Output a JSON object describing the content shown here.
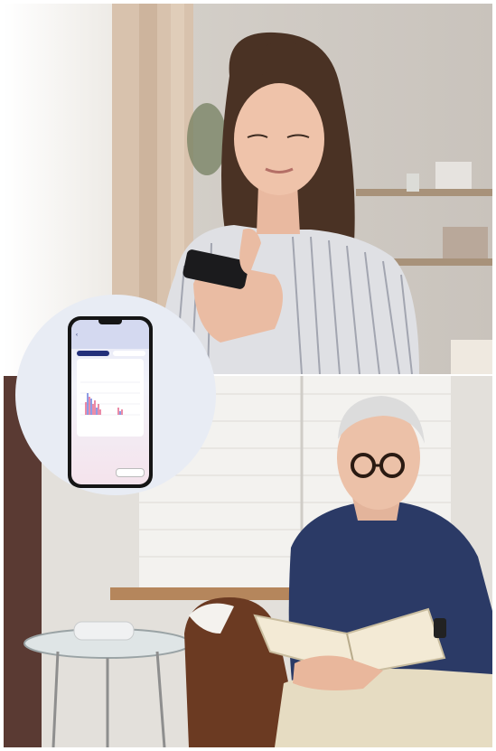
{
  "phone_screen": {
    "header_small": "",
    "title": "",
    "tabs": [
      "",
      ""
    ],
    "card_title": "",
    "legend": "",
    "button": ""
  },
  "chart_data": {
    "type": "bar",
    "categories": [],
    "series": []
  }
}
